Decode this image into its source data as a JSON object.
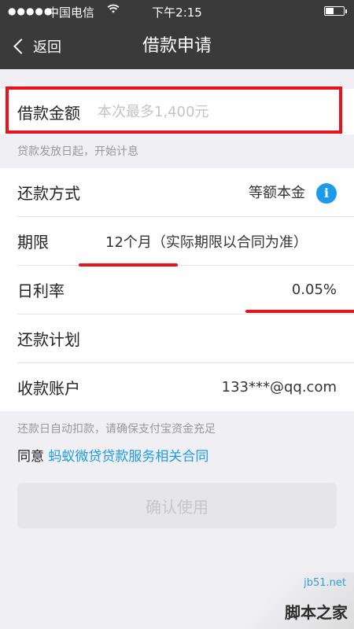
{
  "status_bar": {
    "signal_dots": "●●●●●",
    "carrier": "中国电信",
    "wifi_icon": "wifi-icon",
    "time": "下午2:15"
  },
  "nav": {
    "back_label": "返回",
    "title": "借款申请"
  },
  "amount": {
    "label": "借款金额",
    "placeholder": "本次最多1,400元"
  },
  "hint_interest": "贷款发放日起，开始计息",
  "rows": {
    "repay_method": {
      "label": "还款方式",
      "value": "等额本金",
      "icon": "info-icon"
    },
    "term": {
      "label": "期限",
      "value": "12个月（实际期限以合同为准）"
    },
    "rate": {
      "label": "日利率",
      "value": "0.05%"
    },
    "plan": {
      "label": "还款计划"
    },
    "account": {
      "label": "收款账户",
      "value": "133***@qq.com"
    }
  },
  "hint_deduct": "还款日自动扣款，请确保支付宝资金充足",
  "agreement": {
    "prefix": "同意",
    "link": "蚂蚁微贷贷款服务相关合同"
  },
  "confirm_label": "确认使用",
  "watermark": {
    "site": "jb51.net",
    "brand": "脚本之家"
  },
  "colors": {
    "header_bg": "#3a3a3a",
    "accent_blue": "#1e9be8",
    "annotation_red": "#e8131c",
    "page_bg": "#efeff4"
  }
}
